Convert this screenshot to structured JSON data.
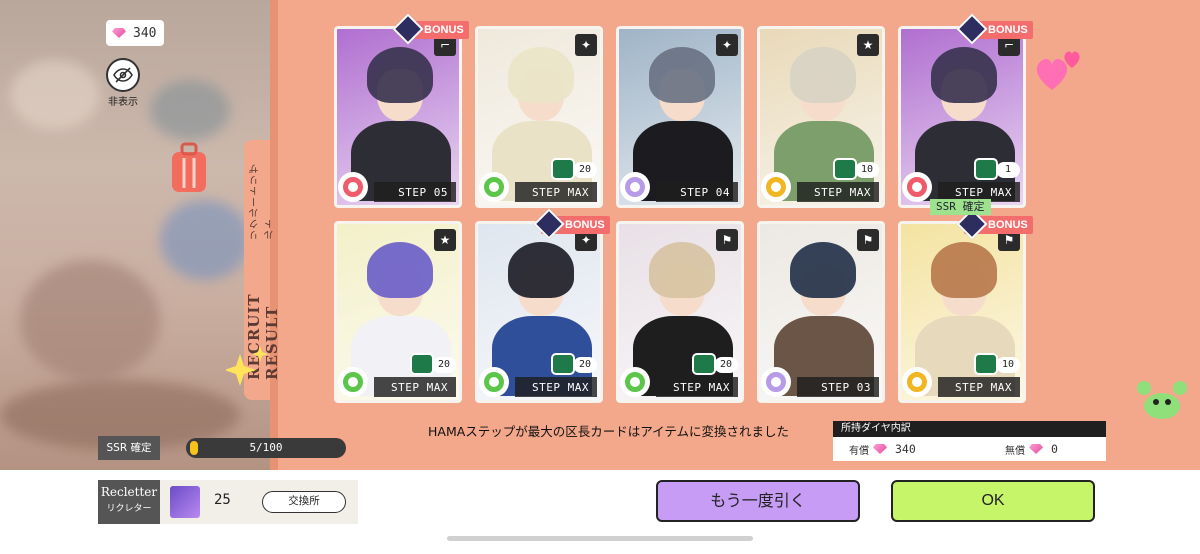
{
  "currency": {
    "gems": "340",
    "hide_label": "非表示"
  },
  "tab": {
    "title": "RECRUIT RESULT",
    "subtitle": "リクルートリザルト"
  },
  "cards": [
    {
      "step": "STEP 05",
      "bonus": "BONUS",
      "item_count": "",
      "attr": "red",
      "type": "gun",
      "hair": "#3a3450",
      "body": "#2d2d35",
      "bg": "#b06fd0"
    },
    {
      "step": "STEP MAX",
      "bonus": "",
      "item_count": "20",
      "attr": "green",
      "type": "wand",
      "hair": "#eae4c8",
      "body": "#e9e2c6",
      "bg": "#efe9dc"
    },
    {
      "step": "STEP 04",
      "bonus": "",
      "item_count": "",
      "attr": "purple",
      "type": "wand",
      "hair": "#6a7384",
      "body": "#1b1b20",
      "bg": "#9fb4c7"
    },
    {
      "step": "STEP MAX",
      "bonus": "",
      "item_count": "10",
      "attr": "yellow",
      "type": "star",
      "hair": "#d8d3c4",
      "body": "#7d9f6b",
      "bg": "#e8d9b8"
    },
    {
      "step": "STEP MAX",
      "bonus": "BONUS",
      "item_count": "1",
      "attr": "red",
      "type": "gun",
      "hair": "#3a3450",
      "body": "#2d2d35",
      "bg": "#b06fd0"
    },
    {
      "step": "STEP MAX",
      "bonus": "",
      "item_count": "20",
      "attr": "green",
      "type": "star",
      "hair": "#6b5fc8",
      "body": "#f2f2f6",
      "bg": "#f3f0c8"
    },
    {
      "step": "STEP MAX",
      "bonus": "BONUS",
      "item_count": "20",
      "attr": "green",
      "type": "wand",
      "hair": "#1d1d28",
      "body": "#2f4f9a",
      "bg": "#dfe6ef"
    },
    {
      "step": "STEP MAX",
      "bonus": "",
      "item_count": "20",
      "attr": "green",
      "type": "flag",
      "hair": "#d7c3a2",
      "body": "#1e1e1e",
      "bg": "#e8e0e6"
    },
    {
      "step": "STEP 03",
      "bonus": "",
      "item_count": "",
      "attr": "purple",
      "type": "flag",
      "hair": "#24324a",
      "body": "#6b5546",
      "bg": "#ece8e2"
    },
    {
      "step": "STEP MAX",
      "bonus": "BONUS",
      "item_count": "10",
      "attr": "yellow",
      "type": "flag",
      "hair": "#b9794d",
      "body": "#e7d9bb",
      "bg": "#f4e3a1"
    }
  ],
  "ssr_confirmed_tag": "SSR 確定",
  "notice": "HAMAステップが最大の区長カードはアイテムに変換されました",
  "diamonds": {
    "header": "所持ダイヤ内訳",
    "paid_label": "有償",
    "paid_value": "340",
    "free_label": "無償",
    "free_value": "0"
  },
  "ssr_progress": {
    "label": "SSR 確定",
    "text": "5/100",
    "value": 0.05
  },
  "recletter": {
    "title_en": "Recletter",
    "title_jp": "リクレター",
    "count": "25",
    "exchange_label": "交換所"
  },
  "buttons": {
    "again": "もう一度引く",
    "ok": "OK"
  },
  "colors": {
    "panel": "#f4a88b",
    "attr_red": "#ef5b6a",
    "attr_green": "#5cc64a",
    "attr_purple": "#b79be8",
    "attr_yellow": "#f3b623"
  }
}
